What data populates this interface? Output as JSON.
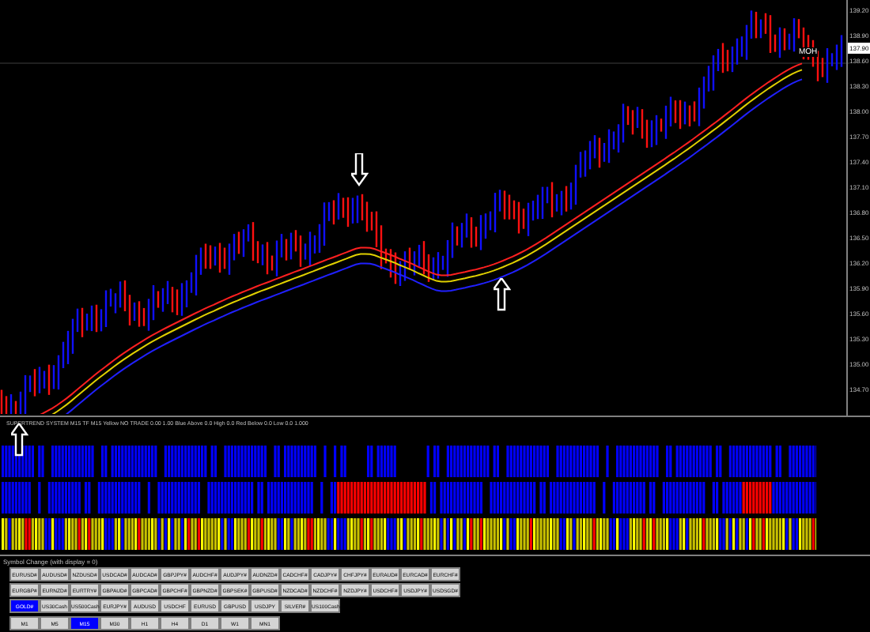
{
  "chart": {
    "current_price": "137.90",
    "axis_labels": [
      "139.20",
      "138.90",
      "138.60",
      "138.30",
      "138.00",
      "137.70",
      "137.40",
      "137.10",
      "136.80",
      "136.50",
      "136.20",
      "135.90",
      "135.60",
      "135.30",
      "135.00",
      "134.70"
    ],
    "line_label": "MOH"
  },
  "indicator": {
    "label": "SUPERTREND SYSTEM M15 TF M15 Yellow NO TRADE 0.00 1.00 Blue Above 0.0 High 0.0 Red Below 0.0 Low 0.0 1.000"
  },
  "symbol_panel": {
    "title": "Symbol Change (with display = 0)",
    "symbols": [
      {
        "label": "EURUSD#",
        "selected": false
      },
      {
        "label": "AUDUSD#",
        "selected": false
      },
      {
        "label": "NZDUSD#",
        "selected": false
      },
      {
        "label": "USDCAD#",
        "selected": false
      },
      {
        "label": "AUDCAD#",
        "selected": false
      },
      {
        "label": "GBPJPY#",
        "selected": false
      },
      {
        "label": "AUDCHF#",
        "selected": false
      },
      {
        "label": "AUDJPY#",
        "selected": false
      },
      {
        "label": "AUDNZD#",
        "selected": false
      },
      {
        "label": "CADCHF#",
        "selected": false
      },
      {
        "label": "CADJPY#",
        "selected": false
      },
      {
        "label": "CHFJPY#",
        "selected": false
      },
      {
        "label": "EURAUD#",
        "selected": false
      },
      {
        "label": "EURCAD#",
        "selected": false
      },
      {
        "label": "EURCHF#",
        "selected": false
      },
      {
        "label": "EURGBP#",
        "selected": false
      },
      {
        "label": "EURNZD#",
        "selected": false
      },
      {
        "label": "EURTRY#",
        "selected": false
      },
      {
        "label": "GBPAUD#",
        "selected": false
      },
      {
        "label": "GBPCAD#",
        "selected": false
      },
      {
        "label": "GBPCHF#",
        "selected": false
      },
      {
        "label": "GBPNZD#",
        "selected": false
      },
      {
        "label": "GBPSEK#",
        "selected": false
      },
      {
        "label": "GBPUSD#",
        "selected": false
      },
      {
        "label": "NZDCAD#",
        "selected": false
      },
      {
        "label": "NZDCHF#",
        "selected": false
      },
      {
        "label": "NZDJPY#",
        "selected": false
      },
      {
        "label": "USDCHF#",
        "selected": false
      },
      {
        "label": "USDJPY#",
        "selected": false
      },
      {
        "label": "USDSGD#",
        "selected": false
      },
      {
        "label": "GOLD#",
        "selected": true
      },
      {
        "label": "US30Cash",
        "selected": false
      },
      {
        "label": "US500Cash",
        "selected": false
      },
      {
        "label": "EURJPY#",
        "selected": false
      },
      {
        "label": "AUDUSD",
        "selected": false
      },
      {
        "label": "USDCHF",
        "selected": false
      },
      {
        "label": "EURUSD",
        "selected": false
      },
      {
        "label": "GBPUSD",
        "selected": false
      },
      {
        "label": "USDJPY",
        "selected": false
      },
      {
        "label": "SILVER#",
        "selected": false
      },
      {
        "label": "US100Cash",
        "selected": false
      }
    ],
    "timeframes": [
      {
        "label": "M1",
        "selected": false
      },
      {
        "label": "M5",
        "selected": false
      },
      {
        "label": "M15",
        "selected": true
      },
      {
        "label": "M30",
        "selected": false
      },
      {
        "label": "H1",
        "selected": false
      },
      {
        "label": "H4",
        "selected": false
      },
      {
        "label": "D1",
        "selected": false
      },
      {
        "label": "W1",
        "selected": false
      },
      {
        "label": "MN1",
        "selected": false
      }
    ]
  }
}
